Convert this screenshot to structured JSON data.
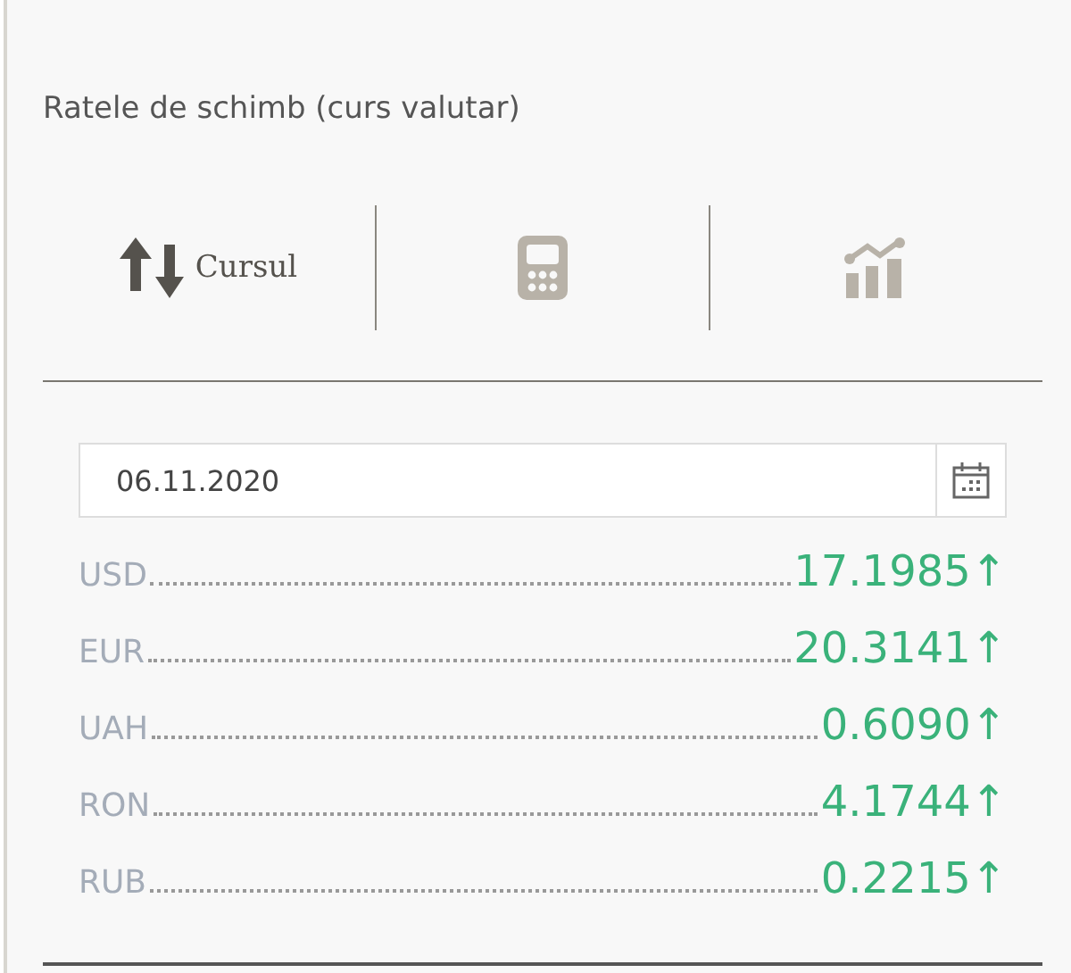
{
  "title": "Ratele de schimb (curs valutar)",
  "tabs": [
    {
      "kind": "rates",
      "label": "Cursul",
      "selected": true
    },
    {
      "kind": "calculator",
      "selected": false
    },
    {
      "kind": "chart",
      "selected": false
    }
  ],
  "date_field": {
    "value": "06.11.2020"
  },
  "rates": [
    {
      "currency": "USD",
      "value": "17.1985",
      "arrow": "↑"
    },
    {
      "currency": "EUR",
      "value": "20.3141",
      "arrow": "↑"
    },
    {
      "currency": "UAH",
      "value": "0.6090",
      "arrow": "↑"
    },
    {
      "currency": "RON",
      "value": "4.1744",
      "arrow": "↑"
    },
    {
      "currency": "RUB",
      "value": "0.2215",
      "arrow": "↑"
    }
  ]
}
